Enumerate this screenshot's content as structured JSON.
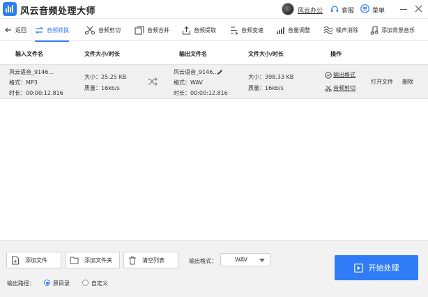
{
  "window": {
    "title": "风云音频处理大师",
    "user": "风云办公",
    "service": "客服",
    "menu": "菜单"
  },
  "toolbar": {
    "items": [
      {
        "label": "返回",
        "icon": "back-arrow-icon"
      },
      {
        "label": "音频转换",
        "icon": "convert-icon",
        "active": true
      },
      {
        "label": "音频剪切",
        "icon": "scissors-icon"
      },
      {
        "label": "音频合并",
        "icon": "merge-icon"
      },
      {
        "label": "音频提取",
        "icon": "extract-icon"
      },
      {
        "label": "音频变速",
        "icon": "speed-icon"
      },
      {
        "label": "音量调整",
        "icon": "volume-bars-icon"
      },
      {
        "label": "噪声消除",
        "icon": "noise-wave-icon"
      },
      {
        "label": "添加背景音乐",
        "icon": "music-note-icon"
      }
    ]
  },
  "table": {
    "headers": {
      "input_name": "输入文件名",
      "input_size": "文件大小/时长",
      "output_name": "输出文件名",
      "output_size": "文件大小/时长",
      "ops": "操作"
    },
    "rows": [
      {
        "input_name": "风云语音_9146...",
        "input_format": "格式：MP3",
        "input_duration": "时长：00:00:12.816",
        "input_size": "大小：25.25 KB",
        "input_quality": "质量：16kb/s",
        "output_name": "风云语音_9146...",
        "output_format": "格式：WAV",
        "output_duration": "时长：00:00:12.816",
        "output_size": "大小：398.33 KB",
        "output_quality": "质量：16kb/s",
        "op_format": "输出格式",
        "op_cut": "音频剪切",
        "op_open": "打开文件",
        "op_delete": "删除"
      }
    ]
  },
  "bottom": {
    "add_file": "添加文件",
    "add_folder": "添加文件夹",
    "clear_list": "清空列表",
    "format_label": "输出格式：",
    "format_value": "WAV",
    "start": "开始处理",
    "path_label": "输出路径：",
    "path_original": "原目录",
    "path_custom": "自定义"
  },
  "colors": {
    "accent": "#2f7cf6"
  }
}
